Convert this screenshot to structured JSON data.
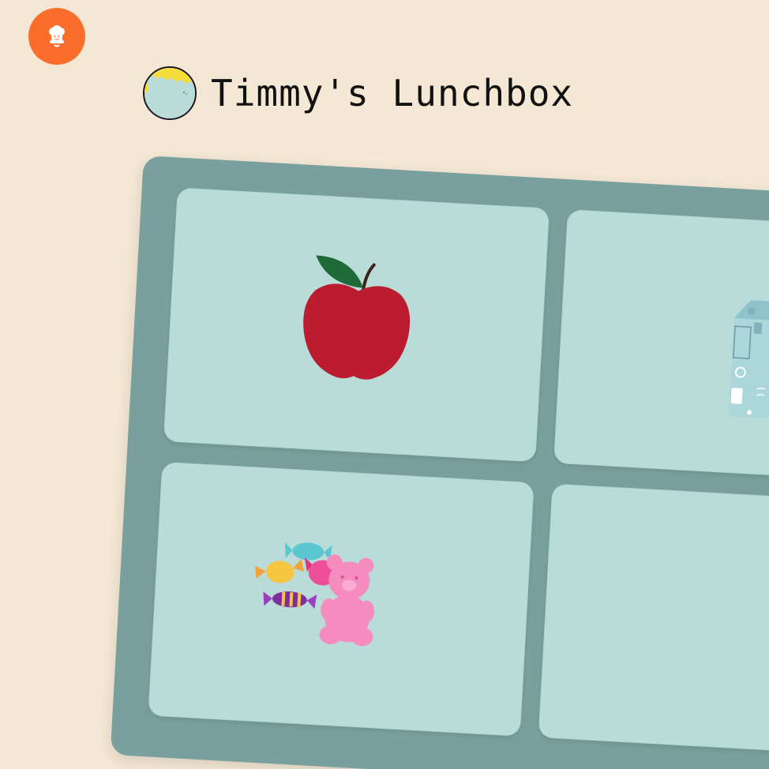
{
  "app": {
    "chef_icon": "chef-hat-icon"
  },
  "header": {
    "title": "Timmy's Lunchbox",
    "avatar_icon": "child-avatar-icon"
  },
  "colors": {
    "background": "#f4e8d4",
    "accent": "#fb6d2a",
    "lunchbox": "#79a09c",
    "compartment": "#b9dcd9"
  },
  "lunchbox": {
    "compartments": [
      {
        "item": "apple",
        "icon": "apple-icon"
      },
      {
        "item": "milk carton",
        "icon": "milk-carton-icon"
      },
      {
        "item": "candy",
        "icon": "candy-and-gummy-bear-icon"
      },
      {
        "item": "",
        "icon": ""
      }
    ]
  }
}
